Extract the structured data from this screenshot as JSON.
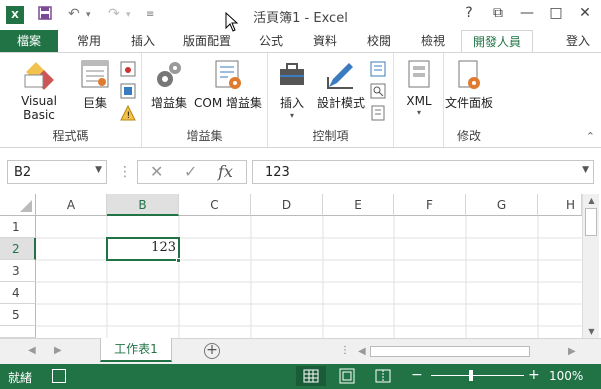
{
  "titlebar": {
    "title": "活頁簿1 - Excel",
    "help": "?",
    "restore_ribbon": "⧉",
    "minimize": "—",
    "maximize": "□",
    "close": "✕"
  },
  "tabs": [
    "檔案",
    "常用",
    "插入",
    "版面配置",
    "公式",
    "資料",
    "校閱",
    "檢視",
    "開發人員"
  ],
  "signin": "登入",
  "ribbon": {
    "groups": [
      {
        "label": "程式碼",
        "buttons": [
          "Visual Basic",
          "巨集"
        ]
      },
      {
        "label": "增益集",
        "buttons": [
          "增益集",
          "COM 增益集"
        ]
      },
      {
        "label": "控制項",
        "buttons": [
          "插入",
          "設計模式"
        ]
      },
      {
        "label": "",
        "buttons": [
          "XML"
        ]
      },
      {
        "label": "修改",
        "buttons": [
          "文件面板"
        ]
      }
    ]
  },
  "formula": {
    "namebox": "B2",
    "value": "123",
    "fx": "fx"
  },
  "grid": {
    "columns": [
      "A",
      "B",
      "C",
      "D",
      "E",
      "F",
      "G",
      "H"
    ],
    "rows": [
      "1",
      "2",
      "3",
      "4",
      "5"
    ],
    "active_cell_value": "123"
  },
  "sheets": {
    "active": "工作表1"
  },
  "status": {
    "text": "就緒",
    "zoom": "100%",
    "zoom_minus": "−",
    "zoom_plus": "+"
  },
  "colors": {
    "accent": "#217346"
  }
}
